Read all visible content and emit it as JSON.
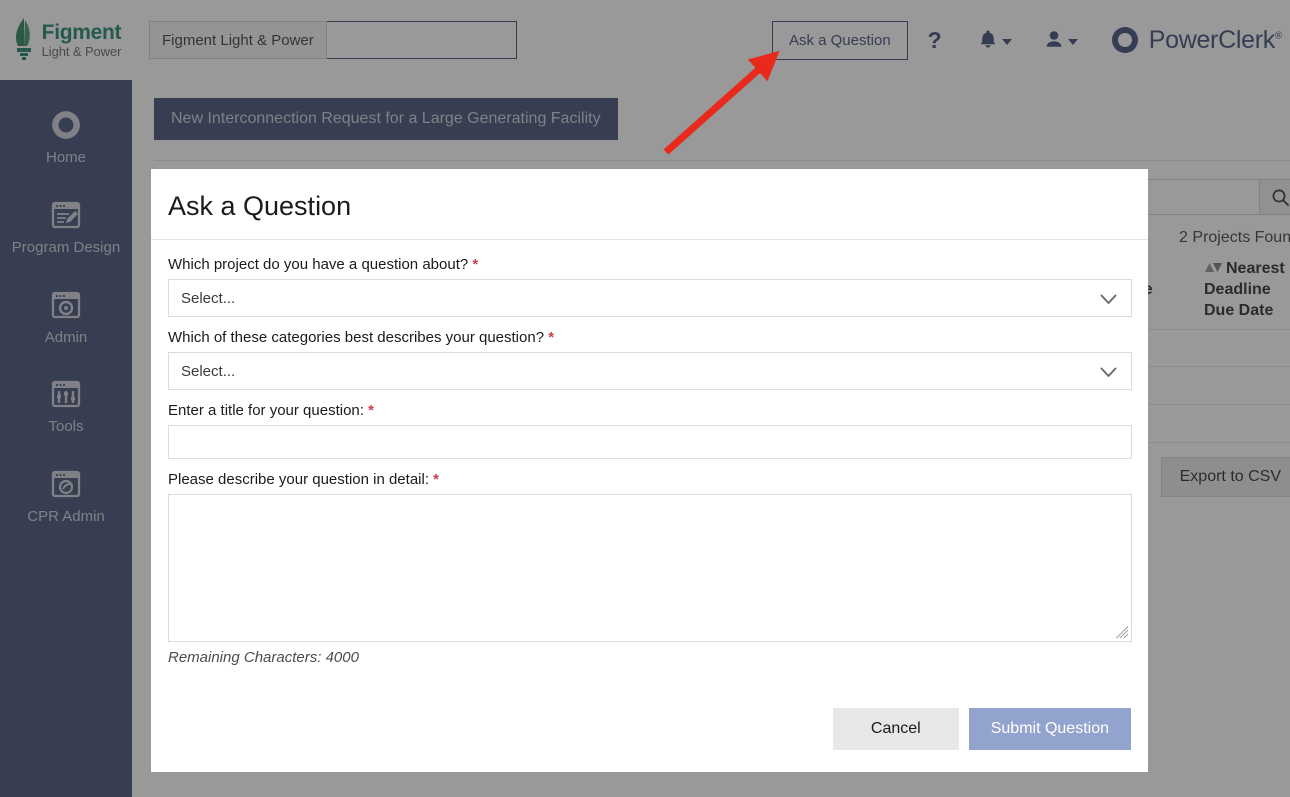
{
  "header": {
    "brand_name": "Figment",
    "brand_sub": "Light & Power",
    "org_label": "Figment Light & Power",
    "org_input_value": "",
    "org_input_placeholder": "",
    "ask_question_label": "Ask a Question",
    "help_label": "?",
    "product_name": "PowerClerk",
    "product_reg": "®",
    "accent_color": "#2f3f6e",
    "brand_color": "#0f7a63"
  },
  "sidebar": {
    "background_color": "#344269",
    "items": [
      {
        "label": "Home",
        "icon": "powerclerk-circle-icon"
      },
      {
        "label": "Program Design",
        "icon": "program-design-icon"
      },
      {
        "label": "Admin",
        "icon": "admin-gear-icon"
      },
      {
        "label": "Tools",
        "icon": "tools-sliders-icon"
      },
      {
        "label": "CPR Admin",
        "icon": "cpr-admin-icon"
      }
    ]
  },
  "main": {
    "banner_label": "New Interconnection Request for a Large Generating Facility",
    "search_value": "",
    "search_placeholder": "",
    "search_icon": "search-icon",
    "projects_found": "2 Projects Found",
    "grid_columns": [
      {
        "label": "Nearest Deadline Name",
        "sortable": false
      },
      {
        "label": "Nearest Deadline Due Date",
        "sortable": true
      }
    ],
    "grid_row_count": 3,
    "export_label": "Export to CSV"
  },
  "modal": {
    "title": "Ask a Question",
    "fields": [
      {
        "label": "Which project do you have a question about?",
        "required_mark": "*",
        "type": "select",
        "value": "Select...",
        "name": "project-select"
      },
      {
        "label": "Which of these categories best describes your question?",
        "required_mark": "*",
        "type": "select",
        "value": "Select...",
        "name": "category-select"
      },
      {
        "label": "Enter a title for your question:",
        "required_mark": "*",
        "type": "text",
        "value": "",
        "placeholder": "",
        "name": "question-title-input"
      },
      {
        "label": "Please describe your question in detail:",
        "required_mark": "*",
        "type": "textarea",
        "value": "",
        "placeholder": "",
        "name": "question-detail-textarea"
      }
    ],
    "remaining_characters": "Remaining Characters: 4000",
    "cancel_label": "Cancel",
    "submit_label": "Submit Question",
    "submit_color": "#92a3cd"
  },
  "annotation": {
    "type": "arrow",
    "color": "#e8291c",
    "points_to": "Ask a Question"
  }
}
